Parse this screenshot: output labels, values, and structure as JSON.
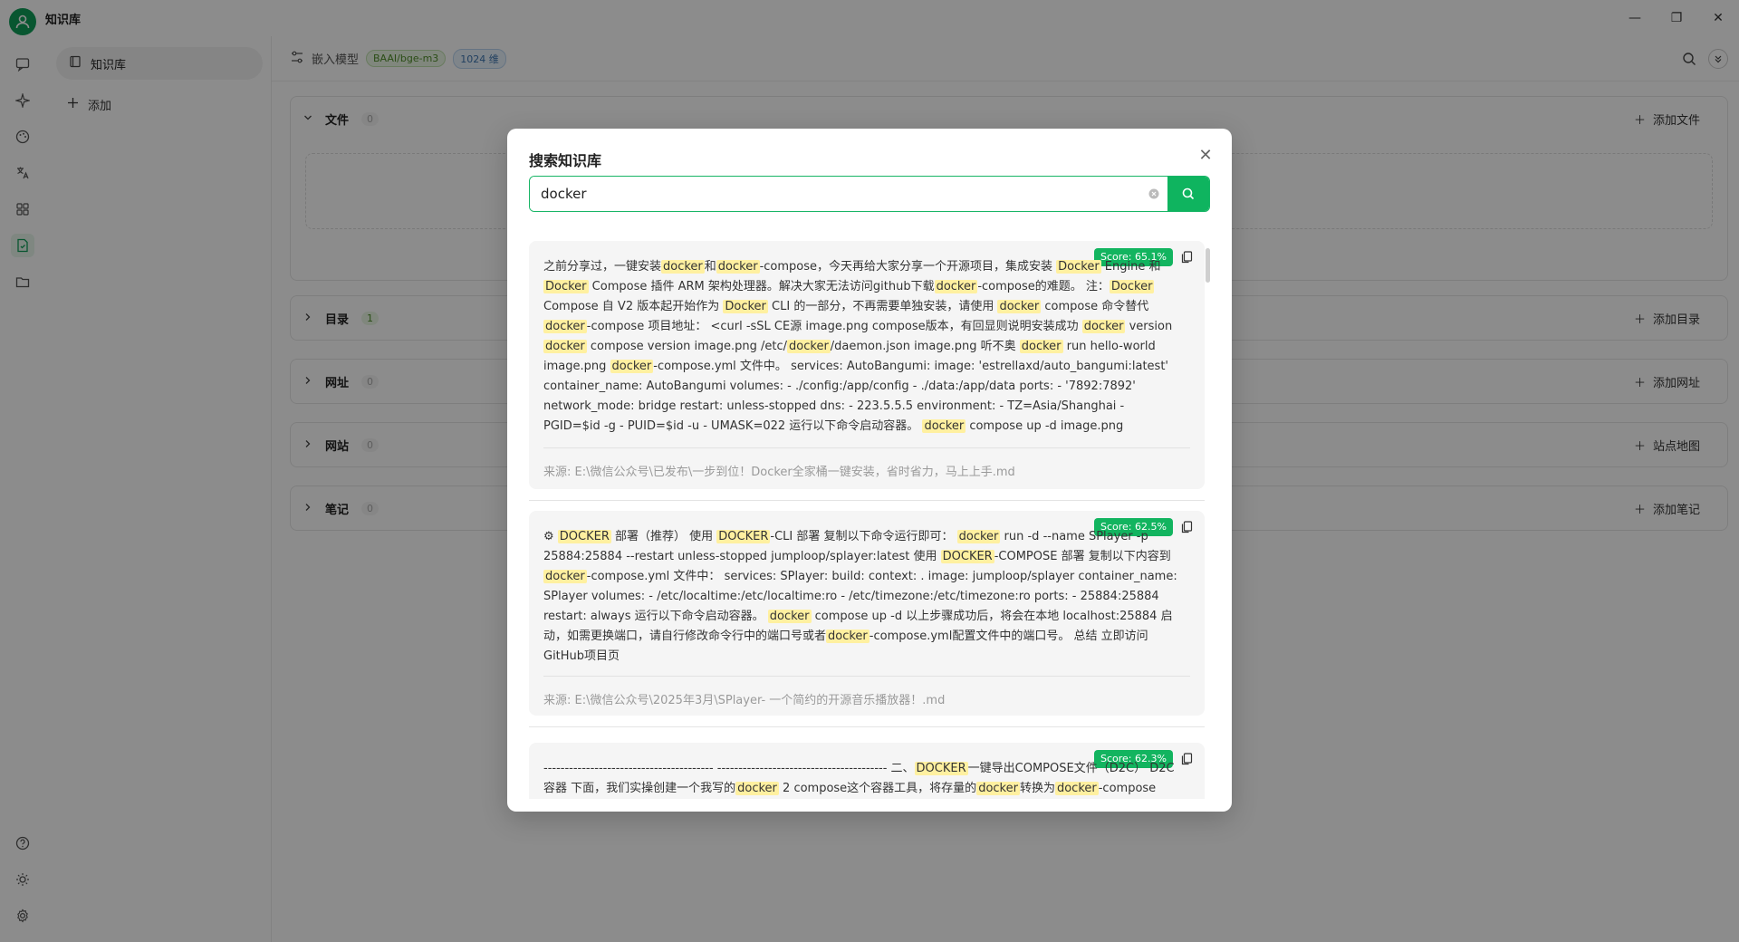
{
  "app": {
    "title": "知识库"
  },
  "window": {
    "minimize": "—",
    "maximize": "❐",
    "close": "✕"
  },
  "sidebar": {
    "kb_item_label": "知识库",
    "add_label": "添加"
  },
  "main": {
    "header": {
      "embed_label": "嵌入模型",
      "model_tag": "BAAI/bge-m3",
      "dim_tag": "1024 维"
    },
    "sections": [
      {
        "title": "文件",
        "count": "0",
        "action": "添加文件"
      },
      {
        "title": "目录",
        "count": "1",
        "action": "添加目录"
      },
      {
        "title": "网址",
        "count": "0",
        "action": "添加网址"
      },
      {
        "title": "网站",
        "count": "0",
        "action": "站点地图"
      },
      {
        "title": "笔记",
        "count": "0",
        "action": "添加笔记"
      }
    ]
  },
  "modal": {
    "title": "搜索知识库",
    "search_value": "docker",
    "results": [
      {
        "score": "Score: 65.1%",
        "source": "来源: E:\\微信公众号\\已发布\\一步到位！Docker全家桶一键安装，省时省力，马上上手.md"
      },
      {
        "score": "Score: 62.5%",
        "source": "来源: E:\\微信公众号\\2025年3月\\SPlayer- 一个简约的开源音乐播放器！.md"
      },
      {
        "score": "Score: 62.3%",
        "source": ""
      }
    ]
  },
  "colors": {
    "accent": "#0fb45f",
    "highlight": "#fff0a0"
  }
}
